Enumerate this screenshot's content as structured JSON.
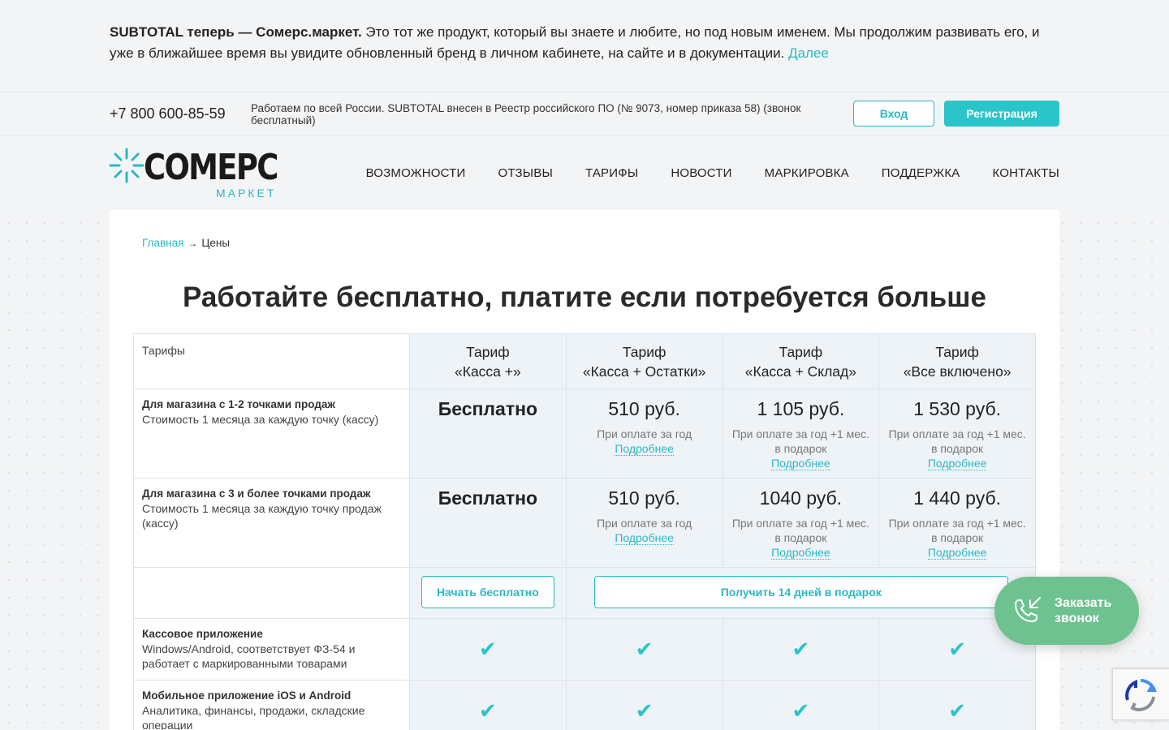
{
  "announcement": {
    "bold": "SUBTOTAL теперь — Сомерс.маркет.",
    "text": " Это тот же продукт, который вы знаете и любите, но под новым именем. Мы продолжим развивать его, и уже в ближайшее время вы увидите обновленный бренд в личном кабинете, на сайте и в документации.",
    "link": "Далее"
  },
  "topbar": {
    "phone": "+7 800 600-85-59",
    "info": "Работаем по всей России. SUBTOTAL внесен в Реестр российского ПО (№ 9073, номер приказа 58) (звонок бесплатный)",
    "login": "Вход",
    "register": "Регистрация"
  },
  "logo": {
    "word": "COMEPC",
    "sub": "МАРКЕТ"
  },
  "nav": [
    "ВОЗМОЖНОСТИ",
    "ОТЗЫВЫ",
    "ТАРИФЫ",
    "НОВОСТИ",
    "МАРКИРОВКА",
    "ПОДДЕРЖКА",
    "КОНТАКТЫ"
  ],
  "breadcrumb": {
    "home": "Главная",
    "arrow": "→",
    "current": "Цены"
  },
  "title": "Работайте бесплатно, платите если потребуется больше",
  "table": {
    "label_header": "Тарифы",
    "plans": [
      {
        "line1": "Тариф",
        "line2": "«Касса +»"
      },
      {
        "line1": "Тариф",
        "line2": "«Касса + Остатки»"
      },
      {
        "line1": "Тариф",
        "line2": "«Касса + Склад»"
      },
      {
        "line1": "Тариф",
        "line2": "«Все включено»"
      }
    ],
    "rows": [
      {
        "title": "Для магазина с 1-2 точками продаж",
        "desc": "Стоимость 1 месяца за каждую точку (кассу)",
        "prices": [
          "Бесплатно",
          "510 руб.",
          "1 105 руб.",
          "1 530 руб."
        ],
        "notes": [
          "",
          "При оплате за год",
          "При оплате за год +1 мес. в подарок",
          "При оплате за год +1 мес. в подарок"
        ]
      },
      {
        "title": "Для магазина с 3 и более точками продаж",
        "desc": "Стоимость 1 месяца за каждую точку продаж (кассу)",
        "prices": [
          "Бесплатно",
          "510 руб.",
          "1040 руб.",
          "1 440 руб."
        ],
        "notes": [
          "",
          "При оплате за год",
          "При оплате за год +1 мес. в подарок",
          "При оплате за год +1 мес. в подарок"
        ]
      }
    ],
    "more_label": "Подробнее",
    "start_button": "Начать бесплатно",
    "gift_button": "Получить 14 дней в подарок",
    "features": [
      {
        "title": "Кассовое приложение",
        "desc": "Windows/Android, соответствует ФЗ-54 и работает с маркированными товарами"
      },
      {
        "title": "Мобильное приложение iOS и Android",
        "desc": "Аналитика, финансы, продажи, складские операции"
      }
    ],
    "check": "✔"
  },
  "callback": {
    "line1": "Заказать",
    "line2": "звонок"
  },
  "colors": {
    "accent": "#2bb8c4",
    "callback": "#6ec28f"
  }
}
